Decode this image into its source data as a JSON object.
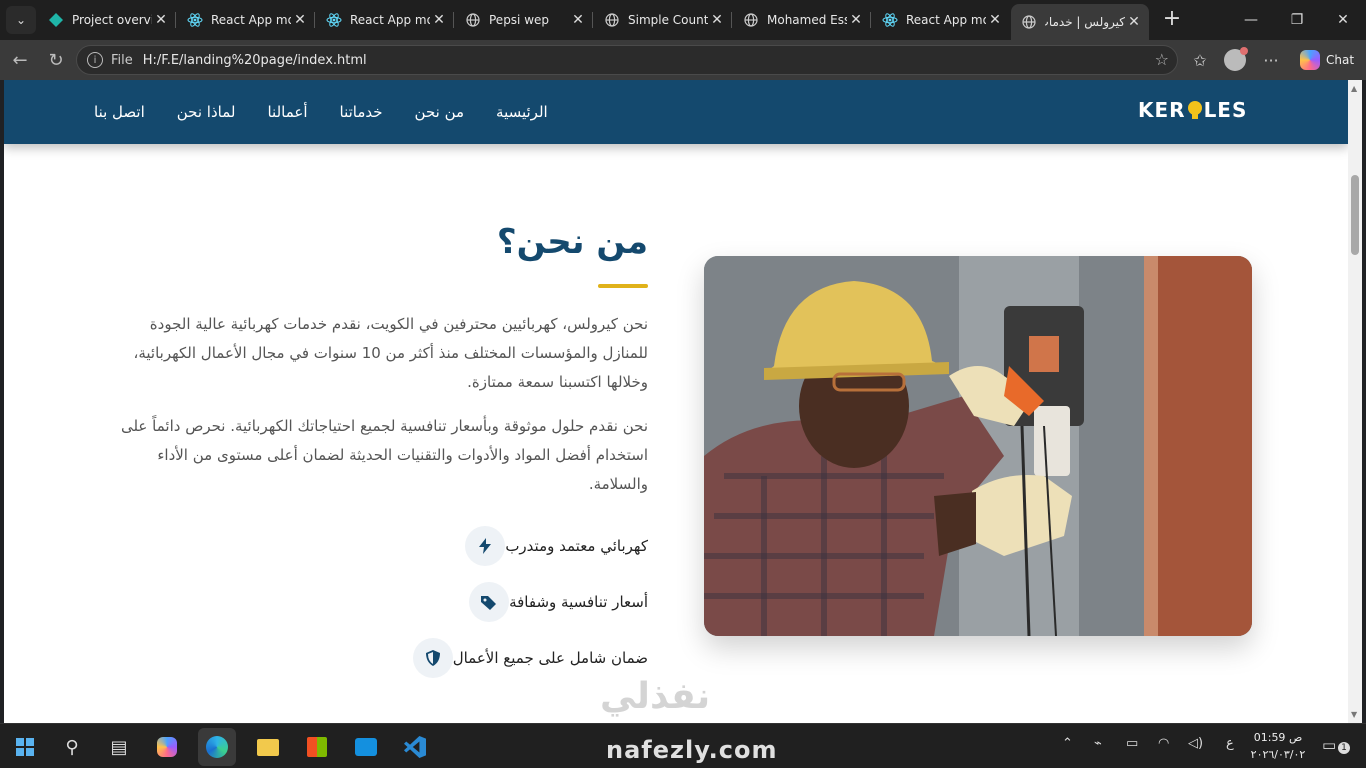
{
  "browser": {
    "tabs": [
      {
        "title": "Project overview",
        "icon": "diamond-icon",
        "icon_color": "#1fb5a8"
      },
      {
        "title": "React App moo",
        "icon": "react-icon",
        "icon_color": "#61dafb"
      },
      {
        "title": "React App moo",
        "icon": "react-icon",
        "icon_color": "#61dafb"
      },
      {
        "title": "Pepsi wep",
        "icon": "globe-icon",
        "icon_color": "#cccccc"
      },
      {
        "title": "Simple Counter",
        "icon": "globe-icon",
        "icon_color": "#cccccc"
      },
      {
        "title": "Mohamed Essa",
        "icon": "globe-icon",
        "icon_color": "#cccccc"
      },
      {
        "title": "React App moo",
        "icon": "react-icon",
        "icon_color": "#61dafb"
      },
      {
        "title": "كيرولس | خدمات",
        "icon": "globe-icon",
        "icon_color": "#cccccc",
        "active": true
      }
    ],
    "address": {
      "scheme_label": "File",
      "url": "H:/F.E/landing%20page/index.html"
    },
    "chat_label": "Chat"
  },
  "site": {
    "logo_text": "KEROLES",
    "nav": [
      "الرئيسية",
      "من نحن",
      "خدماتنا",
      "أعمالنا",
      "لماذا نحن",
      "اتصل بنا"
    ],
    "about": {
      "title": "من نحن؟",
      "paragraph1": "نحن كيرولس، كهربائيين محترفين في الكويت، نقدم خدمات كهربائية عالية الجودة للمنازل والمؤسسات المختلف منذ أكثر من 10 سنوات في مجال الأعمال الكهربائية، وخلالها اكتسبنا سمعة ممتازة.",
      "paragraph2": "نحن نقدم حلول موثوقة وبأسعار تنافسية لجميع احتياجاتك الكهربائية. نحرص دائماً على استخدام أفضل المواد والأدوات والتقنيات الحديثة لضمان أعلى مستوى من الأداء والسلامة.",
      "features": [
        {
          "label": "كهربائي معتمد ومتدرب",
          "icon": "bolt-icon"
        },
        {
          "label": "أسعار تنافسية وشفافة",
          "icon": "tags-icon"
        },
        {
          "label": "ضمان شامل على جميع الأعمال",
          "icon": "shield-icon"
        }
      ]
    },
    "accent_color": "#e0b21a",
    "primary_color": "#14496e"
  },
  "watermark": {
    "arabic": "نفذلي",
    "latin": "nafezly.com"
  },
  "taskbar": {
    "clock_time": "01:59 ص",
    "clock_date": "٢٠٢٦/٠٣/٠٢",
    "lang": "ع",
    "notifications": "1"
  }
}
